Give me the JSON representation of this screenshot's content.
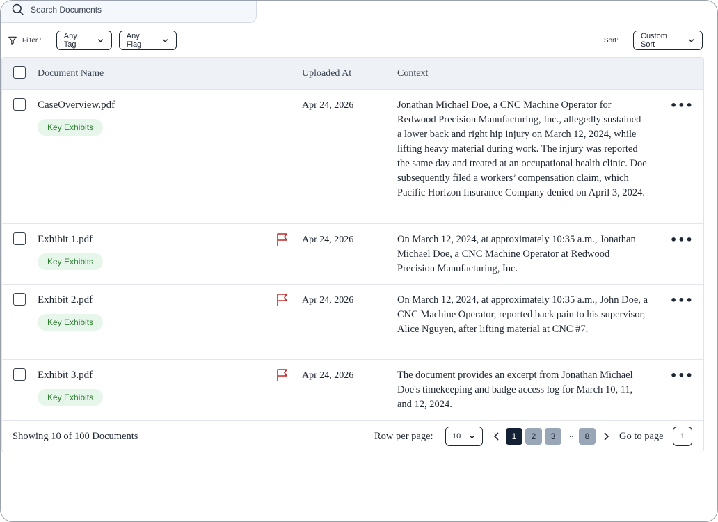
{
  "search": {
    "placeholder": "Search Documents",
    "icon": "search-icon"
  },
  "filters": {
    "label": "Filter :",
    "tag": "Any Tag",
    "flag": "Any Flag"
  },
  "sort": {
    "label": "Sort:",
    "value": "Custom Sort"
  },
  "table": {
    "headers": {
      "name": "Document Name",
      "uploaded": "Uploaded At",
      "context": "Context"
    },
    "rows": [
      {
        "name": "CaseOverview.pdf",
        "tag": "Key Exhibits",
        "flagged": false,
        "uploaded": "Apr 24, 2026",
        "context": "Jonathan Michael Doe, a CNC Machine Operator for Redwood Precision Manufacturing, Inc., allegedly sustained a lower back and right hip injury on March 12, 2024, while lifting heavy material during work. The injury was reported the same day and treated at an occupational health clinic. Doe subsequently filed a workers’ compensation claim, which Pacific Horizon Insurance Company denied on April 3, 2024.",
        "more": "•••"
      },
      {
        "name": "Exhibit 1.pdf",
        "tag": "Key Exhibits",
        "flagged": true,
        "uploaded": "Apr 24, 2026",
        "context": "On March 12, 2024, at approximately 10:35 a.m., Jonathan Michael Doe, a CNC Machine Operator at Redwood Precision Manufacturing, Inc.",
        "more": "•••"
      },
      {
        "name": "Exhibit 2.pdf",
        "tag": "Key Exhibits",
        "flagged": true,
        "uploaded": "Apr 24, 2026",
        "context": "On March 12, 2024, at approximately 10:35 a.m., John Doe, a CNC Machine Operator, reported back pain to his supervisor, Alice Nguyen, after lifting material at CNC #7.",
        "more": "•••"
      },
      {
        "name": "Exhibit 3.pdf",
        "tag": "Key Exhibits",
        "flagged": true,
        "uploaded": "Apr 24, 2026",
        "context": "The document provides an excerpt from Jonathan Michael Doe's timekeeping and badge access log for March 10, 11, and 12, 2024.",
        "more": "•••"
      }
    ]
  },
  "footer": {
    "showing": "Showing 10 of 100 Documents",
    "rows_per_page_label": "Row per page:",
    "rows_per_page": "10",
    "pages": [
      "1",
      "2",
      "3",
      "8"
    ],
    "current_page": "1",
    "ellipsis": "...",
    "goto_label": "Go to page",
    "goto_value": "1"
  },
  "colors": {
    "flag": "#c62828",
    "tag_bg": "#e6f6ea",
    "tag_text": "#2e7d32",
    "page_active": "#142033",
    "page_inactive": "#98a6b8",
    "header_bg": "#eef2f6"
  }
}
